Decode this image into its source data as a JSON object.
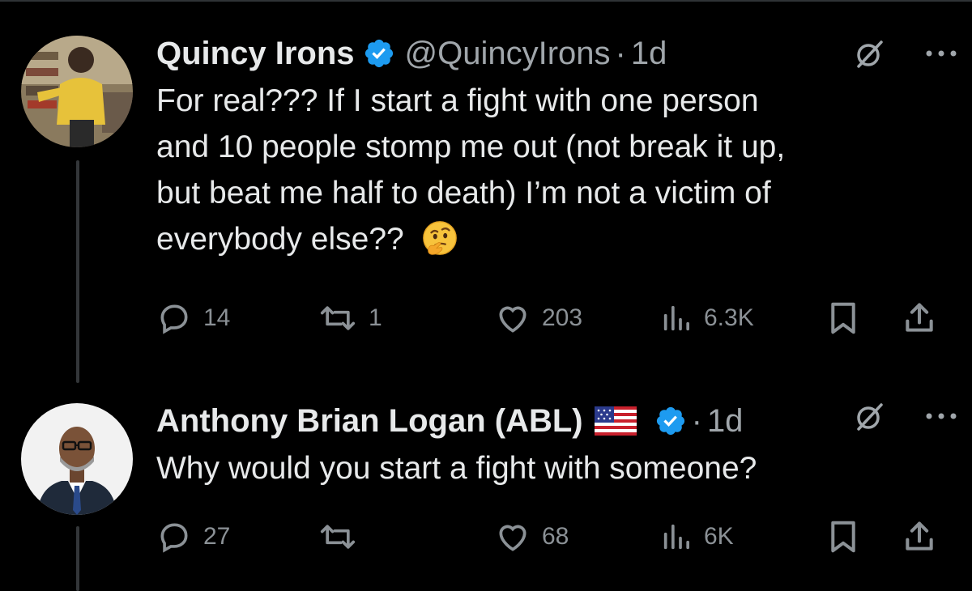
{
  "tweets": [
    {
      "author": {
        "display_name": "Quincy Irons",
        "handle": "@QuincyIrons",
        "verified": true
      },
      "time": "1d",
      "text_lines": [
        "For real??? If I start a fight with one person",
        "and 10 people stomp me out (not break it up,",
        "but beat me half to death) I’m not a victim of",
        "everybody else?? "
      ],
      "emoji": "thinking-face",
      "stats": {
        "replies": "14",
        "reposts": "1",
        "likes": "203",
        "views": "6.3K"
      }
    },
    {
      "author": {
        "display_name": "Anthony Brian Logan (ABL)",
        "flag": "us-flag",
        "verified": true
      },
      "time": "1d",
      "text_lines": [
        "Why would you start a fight with someone?"
      ],
      "stats": {
        "replies": "27",
        "reposts": "",
        "likes": "68",
        "views": "6K"
      }
    }
  ],
  "colors": {
    "background": "#000000",
    "text": "#e7e9ea",
    "secondary": "#8b9196",
    "verified_blue": "#1d9bf0"
  }
}
